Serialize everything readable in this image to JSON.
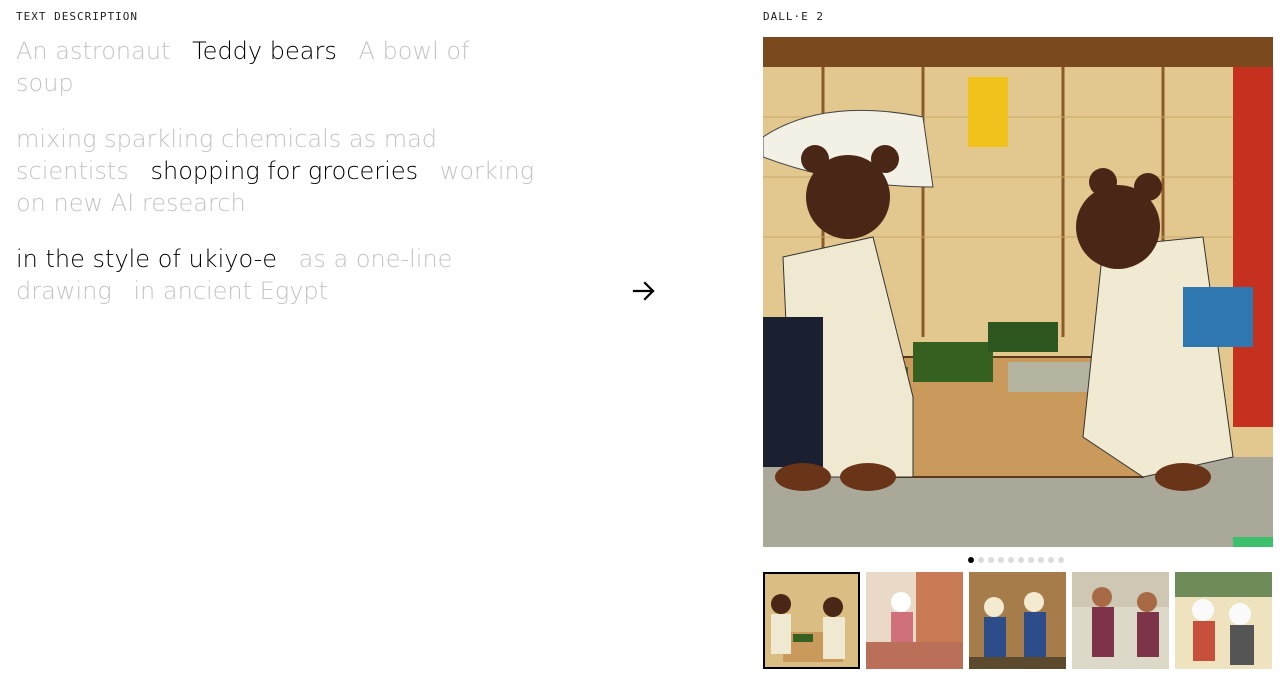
{
  "left_label": "TEXT DESCRIPTION",
  "right_label": "DALL·E 2",
  "groups": [
    {
      "options": [
        "An astronaut",
        "Teddy bears",
        "A bowl of soup"
      ],
      "selected": 1
    },
    {
      "options": [
        "mixing sparkling chemicals as mad scientists",
        "shopping for groceries",
        "working on new AI research"
      ],
      "selected": 1
    },
    {
      "options": [
        "in the style of ukiyo-e",
        "as a one-line drawing",
        "in ancient Egypt"
      ],
      "selected": 0
    }
  ],
  "carousel": {
    "dot_count": 10,
    "active_dot": 0
  },
  "thumbnails": {
    "count": 5,
    "active": 0
  }
}
